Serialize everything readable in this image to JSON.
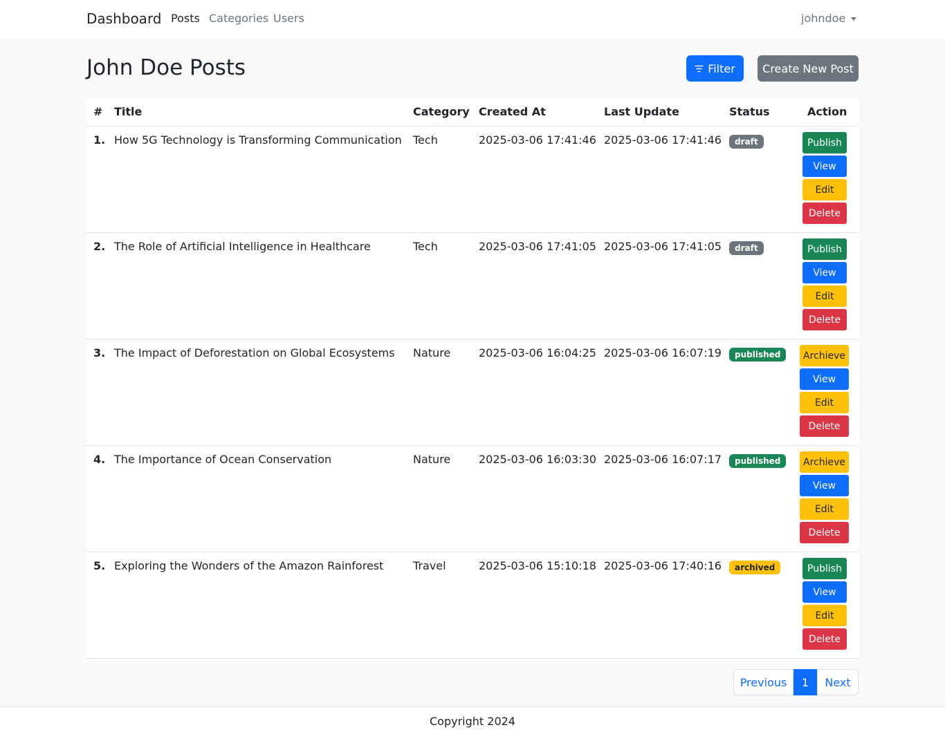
{
  "navbar": {
    "brand": "Dashboard",
    "links": [
      "Posts",
      "Categories",
      "Users"
    ],
    "user": "johndoe"
  },
  "page": {
    "title": "John Doe Posts",
    "filter_label": "Filter",
    "create_label": "Create New Post"
  },
  "table": {
    "headers": [
      "#",
      "Title",
      "Category",
      "Created At",
      "Last Update",
      "Status",
      "Action"
    ],
    "rows": [
      {
        "num": "1.",
        "title": "How 5G Technology is Transforming Communication",
        "category": "Tech",
        "created": "2025-03-06 17:41:46",
        "updated": "2025-03-06 17:41:46",
        "status": "draft",
        "primary_action": "Publish"
      },
      {
        "num": "2.",
        "title": "The Role of Artificial Intelligence in Healthcare",
        "category": "Tech",
        "created": "2025-03-06 17:41:05",
        "updated": "2025-03-06 17:41:05",
        "status": "draft",
        "primary_action": "Publish"
      },
      {
        "num": "3.",
        "title": "The Impact of Deforestation on Global Ecosystems",
        "category": "Nature",
        "created": "2025-03-06 16:04:25",
        "updated": "2025-03-06 16:07:19",
        "status": "published",
        "primary_action": "Archieve"
      },
      {
        "num": "4.",
        "title": "The Importance of Ocean Conservation",
        "category": "Nature",
        "created": "2025-03-06 16:03:30",
        "updated": "2025-03-06 16:07:17",
        "status": "published",
        "primary_action": "Archieve"
      },
      {
        "num": "5.",
        "title": "Exploring the Wonders of the Amazon Rainforest",
        "category": "Travel",
        "created": "2025-03-06 15:10:18",
        "updated": "2025-03-06 17:40:16",
        "status": "archived",
        "primary_action": "Publish"
      }
    ],
    "row_actions": [
      "View",
      "Edit",
      "Delete"
    ]
  },
  "pagination": {
    "prev": "Previous",
    "current": "1",
    "next": "Next"
  },
  "footer": {
    "text": "Copyright 2024"
  },
  "colors": {
    "primary": "#0d6efd",
    "secondary": "#6c757d",
    "success": "#198754",
    "warning": "#ffc107",
    "danger": "#dc3545"
  }
}
